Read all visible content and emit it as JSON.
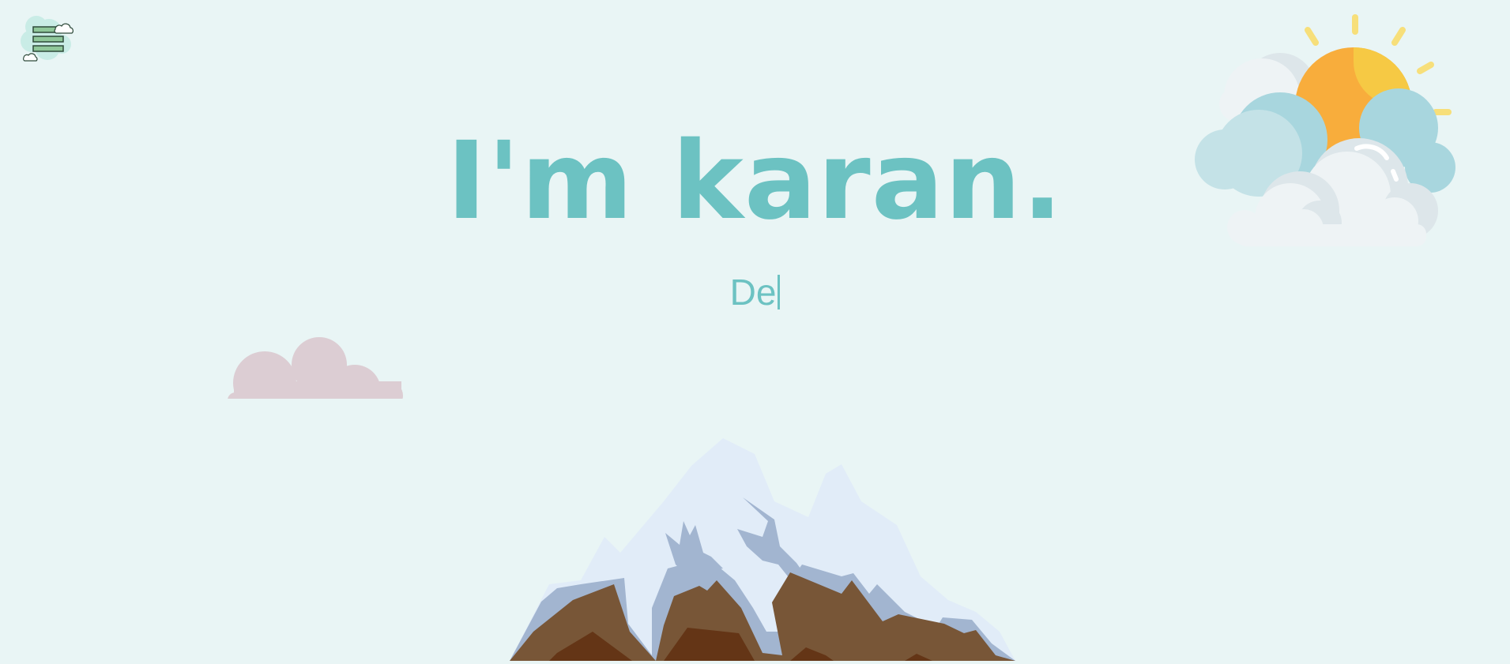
{
  "nav": {
    "menu_icon": "hamburger-cloud-icon"
  },
  "hero": {
    "title": "I'm karan.",
    "typed_text": "De"
  },
  "decor": {
    "weather_icon": "sun-behind-clouds-icon",
    "pink_cloud_icon": "pink-cloud-icon",
    "mountain_icon": "snowy-mountain-illustration"
  },
  "colors": {
    "background": "#e9f5f5",
    "accent": "#6cc2c2",
    "sun": "#f6c944",
    "sun_shade": "#f8ad3c",
    "pink_cloud": "#dccdd3",
    "snow": "#e1ecf8",
    "rock": "#785637"
  }
}
